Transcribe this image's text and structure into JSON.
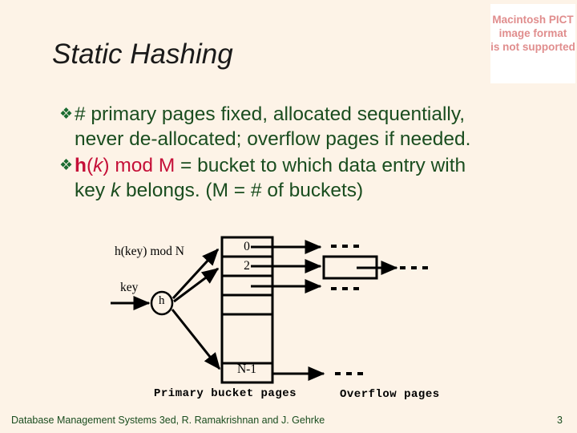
{
  "slide": {
    "background_color": "#fdf3e7",
    "title": "Static Hashing",
    "title_color": "#1a1a1a"
  },
  "pict_placeholder": {
    "line1": "Macintosh PICT",
    "line2": "image format",
    "line3": "is not supported",
    "text_color": "#e08d8d",
    "background_color": "#ffffff"
  },
  "bullets": {
    "marker": "❖",
    "marker_color": "#1a6b30",
    "text_color": "#1a4d1f",
    "accent_color": "#c51038",
    "items": [
      {
        "line1": "# primary pages fixed, allocated sequentially,",
        "line2": "never de-allocated; overflow pages if needed."
      },
      {
        "formula_h": "h",
        "formula_paren_open": "(",
        "formula_k": "k",
        "formula_rest": ") mod M",
        "line1_tail": " = bucket to which data entry with",
        "line2_pre": "key ",
        "line2_k": "k",
        "line2_post": " belongs. (M = # of buckets)"
      }
    ]
  },
  "diagram": {
    "hash_label": "h(key) mod N",
    "key_label": "key",
    "hash_node": "h",
    "bucket_cells": [
      "0",
      "2",
      "",
      "",
      "N-1"
    ],
    "primary_caption": "Primary bucket pages",
    "overflow_caption": "Overflow pages",
    "line_color": "#000000"
  },
  "footer": {
    "citation": "Database Management Systems 3ed,  R. Ramakrishnan and J. Gehrke",
    "page_number": "3",
    "color": "#1a4d1f"
  }
}
